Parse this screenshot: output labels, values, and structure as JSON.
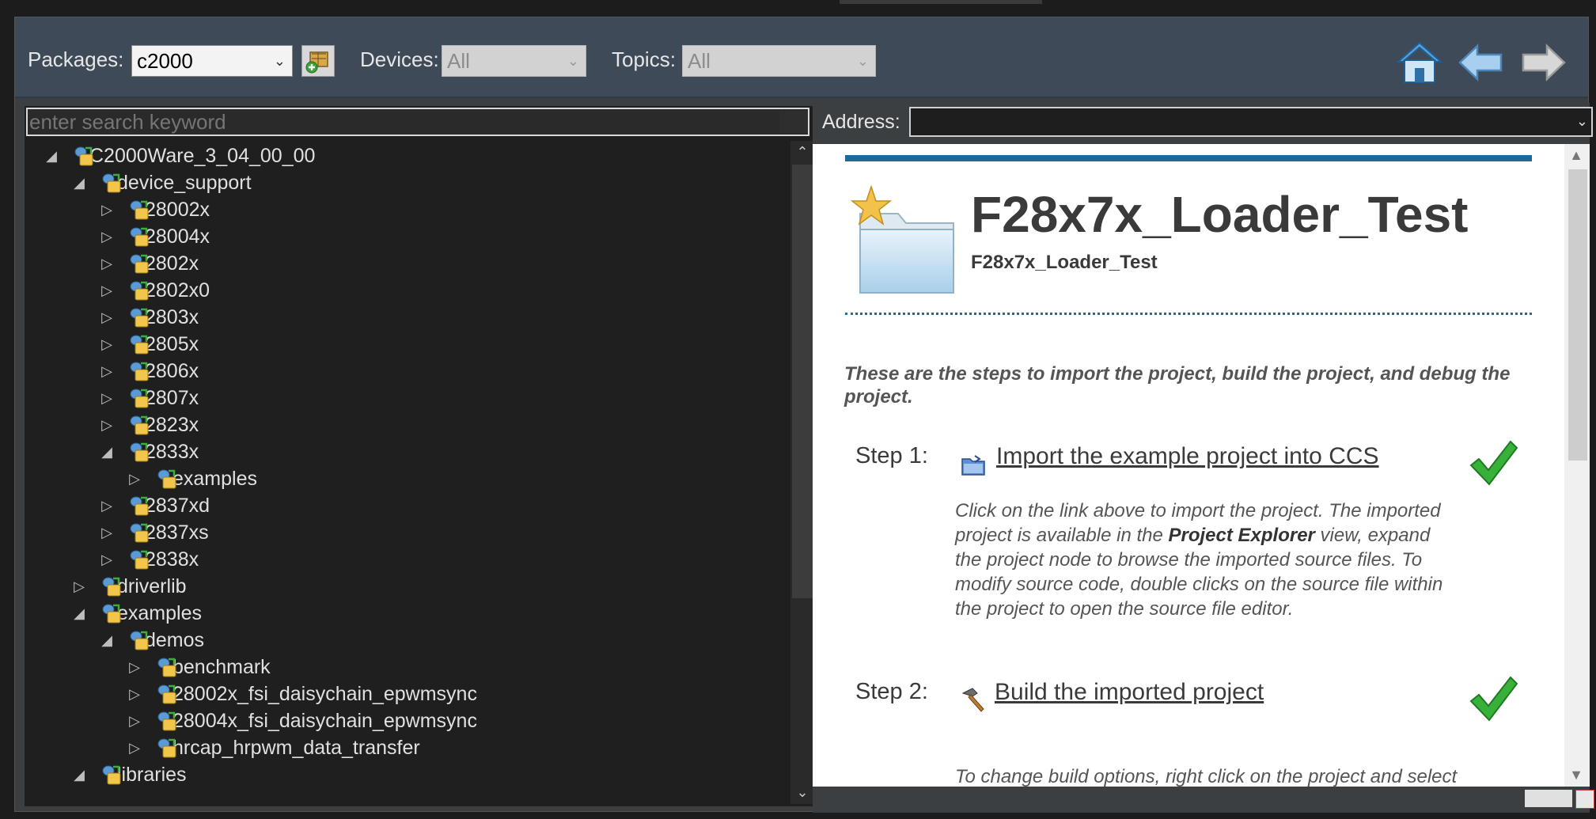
{
  "toolbar": {
    "packages_label": "Packages:",
    "packages_value": "c2000",
    "devices_label": "Devices:",
    "devices_value": "All",
    "topics_label": "Topics:",
    "topics_value": "All"
  },
  "search": {
    "placeholder": "enter search keyword"
  },
  "tree": [
    {
      "label": "C2000Ware_3_04_00_00",
      "level": 0,
      "state": "expanded"
    },
    {
      "label": "device_support",
      "level": 1,
      "state": "expanded"
    },
    {
      "label": "28002x",
      "level": 2,
      "state": "collapsed"
    },
    {
      "label": "28004x",
      "level": 2,
      "state": "collapsed"
    },
    {
      "label": "2802x",
      "level": 2,
      "state": "collapsed"
    },
    {
      "label": "2802x0",
      "level": 2,
      "state": "collapsed"
    },
    {
      "label": "2803x",
      "level": 2,
      "state": "collapsed"
    },
    {
      "label": "2805x",
      "level": 2,
      "state": "collapsed"
    },
    {
      "label": "2806x",
      "level": 2,
      "state": "collapsed"
    },
    {
      "label": "2807x",
      "level": 2,
      "state": "collapsed"
    },
    {
      "label": "2823x",
      "level": 2,
      "state": "collapsed"
    },
    {
      "label": "2833x",
      "level": 2,
      "state": "expanded"
    },
    {
      "label": "examples",
      "level": 3,
      "state": "collapsed"
    },
    {
      "label": "2837xd",
      "level": 2,
      "state": "collapsed"
    },
    {
      "label": "2837xs",
      "level": 2,
      "state": "collapsed"
    },
    {
      "label": "2838x",
      "level": 2,
      "state": "collapsed"
    },
    {
      "label": "driverlib",
      "level": 1,
      "state": "collapsed"
    },
    {
      "label": "examples",
      "level": 1,
      "state": "expanded"
    },
    {
      "label": "demos",
      "level": 2,
      "state": "expanded"
    },
    {
      "label": "benchmark",
      "level": 3,
      "state": "collapsed"
    },
    {
      "label": "28002x_fsi_daisychain_epwmsync",
      "level": 3,
      "state": "collapsed"
    },
    {
      "label": "28004x_fsi_daisychain_epwmsync",
      "level": 3,
      "state": "collapsed"
    },
    {
      "label": "hrcap_hrpwm_data_transfer",
      "level": 3,
      "state": "collapsed"
    },
    {
      "label": "libraries",
      "level": 1,
      "state": "expanded"
    }
  ],
  "address": {
    "label": "Address:",
    "value": ""
  },
  "page": {
    "title": "F28x7x_Loader_Test",
    "subtitle": "F28x7x_Loader_Test",
    "intro": "These are the steps to import the project, build the project, and debug the project.",
    "steps": [
      {
        "label": "Step 1:",
        "link": "Import the example project into CCS",
        "desc_1": "Click on the link above to import the project. The imported project is available in the ",
        "desc_bold": "Project Explorer",
        "desc_2": " view, expand the project node to browse the imported source files. To modify source code, double clicks on the source file within the project to open the source file editor."
      },
      {
        "label": "Step 2:",
        "link": "Build the imported project",
        "desc": "To change build options, right click on the project and select Properties from the context menu. To"
      }
    ]
  },
  "icons": {
    "home": "home-icon",
    "back": "back-arrow-icon",
    "forward": "forward-arrow-icon",
    "add_package": "add-package-icon",
    "tree_node": "package-node-icon",
    "project": "project-folder-icon",
    "import": "import-icon",
    "build": "hammer-icon",
    "check": "checkmark-icon"
  },
  "colors": {
    "toolbar_bg": "#3f4a59",
    "accent_blue": "#1b6a99",
    "check_green": "#2fa82b"
  }
}
